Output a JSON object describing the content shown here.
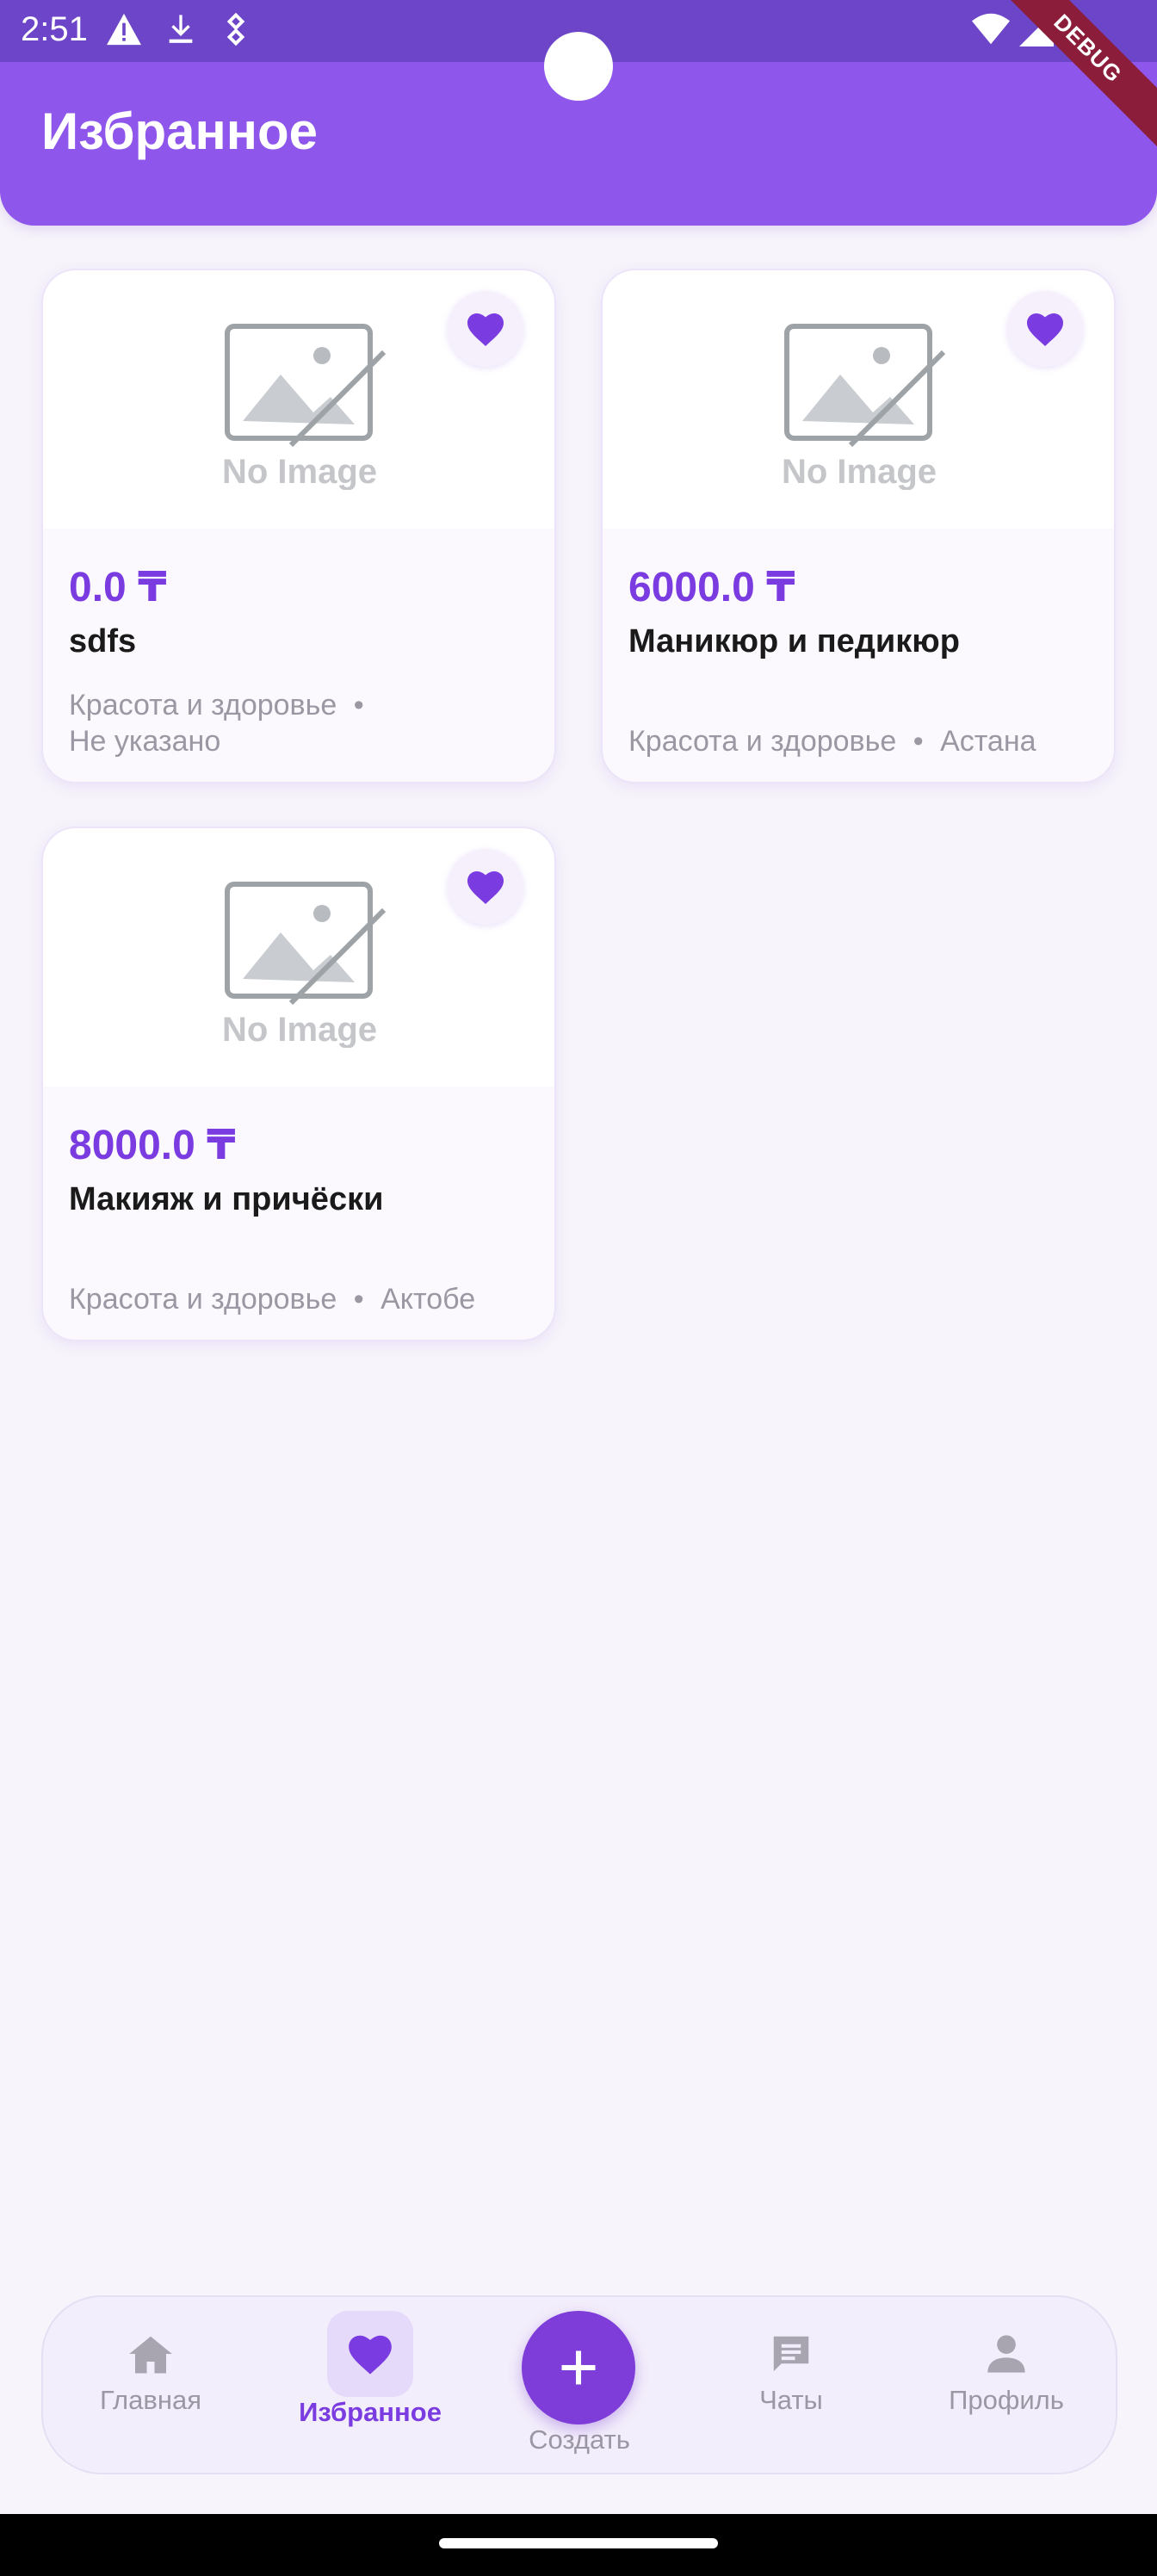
{
  "status_bar": {
    "time": "2:51"
  },
  "debug_label": "DEBUG",
  "header": {
    "title": "Избранное"
  },
  "cards": [
    {
      "image_text": "No Image",
      "price": "0.0 ₸",
      "title": "sdfs",
      "category": "Красота и здоровье",
      "separator": "•",
      "city": "Не указано"
    },
    {
      "image_text": "No Image",
      "price": "6000.0 ₸",
      "title": "Маникюр и педикюр",
      "category": "Красота и здоровье",
      "separator": "•",
      "city": "Астана"
    },
    {
      "image_text": "No Image",
      "price": "8000.0 ₸",
      "title": "Макияж и причёски",
      "category": "Красота и здоровье",
      "separator": "•",
      "city": "Актобе"
    }
  ],
  "nav": {
    "home": "Главная",
    "favorites": "Избранное",
    "create": "Создать",
    "chats": "Чаты",
    "profile": "Профиль"
  },
  "colors": {
    "accent": "#7a3ce0",
    "header": "#8e56ea",
    "background": "#f7f4fb"
  }
}
